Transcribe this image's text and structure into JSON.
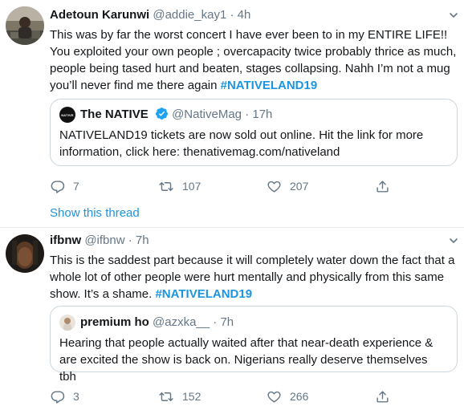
{
  "tweets": [
    {
      "author_name": "Adetoun Karunwi",
      "handle": "@addie_kay1",
      "sep": "·",
      "time": "4h",
      "text": "This was by far the worst concert I have ever been to in my ENTIRE LIFE!! You exploited your own people ; overcapacity twice probably thrice as much, people being tased hurt and beaten, stages collapsing. Nahh I’m not a mug you’ll never find me there again ",
      "hashtag": "#NATIVELAND19",
      "quote": {
        "logo_text": "NATIVE",
        "author_name": "The NATIVE",
        "handle": "@NativeMag",
        "sep": "·",
        "time": "17h",
        "text": "NATIVELAND19 tickets are now sold out online. Hit the link for more information, click here: thenativemag.com/nativeland"
      },
      "replies": "7",
      "retweets": "107",
      "likes": "207",
      "show_thread": "Show this thread"
    },
    {
      "author_name": "ifbnw",
      "handle": "@ifbnw",
      "sep": "·",
      "time": "7h",
      "text": "This is the saddest part because it will completely water down the fact that a whole lot of other people were hurt mentally and physically from this same show. It’s a shame. ",
      "hashtag": "#NATIVELAND19",
      "quote": {
        "author_name": "premium ho",
        "handle": "@azxka__",
        "sep": "·",
        "time": "7h",
        "text": "Hearing that people actually waited after that near-death experience & are excited the show is back on. Nigerians really deserve themselves tbh"
      },
      "replies": "3",
      "retweets": "152",
      "likes": "266"
    }
  ],
  "colors": {
    "link": "#1b95e0",
    "muted": "#657786",
    "border": "#ccd6dd",
    "verified": "#1da1f2"
  }
}
